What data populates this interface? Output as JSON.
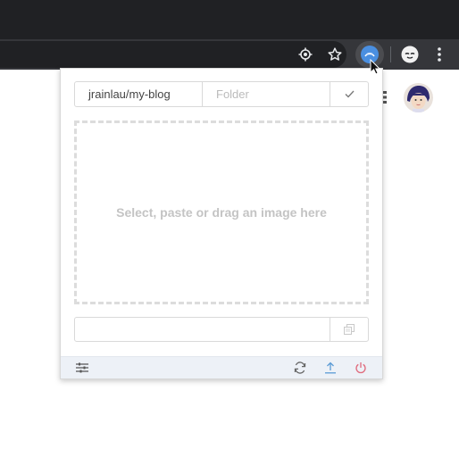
{
  "browser": {
    "toolbar_icons": [
      "location-target-icon",
      "bookmark-star-icon",
      "extension-icon",
      "profile-icon",
      "menu-icon"
    ]
  },
  "popup": {
    "repo": {
      "value": "jrainlau/my-blog"
    },
    "folder": {
      "placeholder": "Folder",
      "value": ""
    },
    "dropzone": {
      "text": "Select, paste or drag an image here"
    },
    "url_field": {
      "value": ""
    },
    "footer": {
      "icons": [
        "settings-sliders-icon",
        "refresh-icon",
        "upload-icon",
        "power-icon"
      ]
    }
  },
  "colors": {
    "upload": "#5b9bd5",
    "power": "#e06b7d",
    "footer_bg": "#edf1f7"
  }
}
